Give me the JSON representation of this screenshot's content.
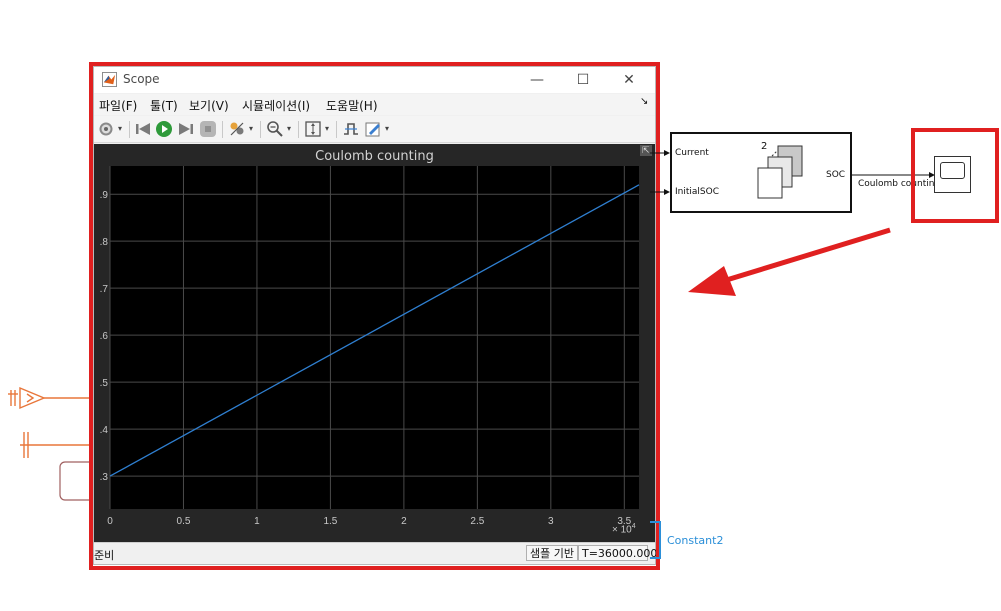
{
  "window": {
    "title": "Scope",
    "minimize": "—",
    "maximize": "☐",
    "close": "✕"
  },
  "menu": {
    "items": [
      "파일(F)",
      "툴(T)",
      "보기(V)",
      "시뮬레이션(I)",
      "도움말(H)"
    ],
    "overflow": "↘"
  },
  "toolbar": {
    "icons": [
      "settings-icon",
      "step-back-icon",
      "run-icon",
      "step-forward-icon",
      "stop-icon",
      "highlight-icon",
      "zoom-icon",
      "scale-axes-icon",
      "triggers-icon",
      "style-icon"
    ],
    "drop": "▾"
  },
  "plot": {
    "title": "Coulomb counting",
    "exponent_base": "× 10",
    "exponent_power": "4",
    "undock_label": "⇱"
  },
  "chart_data": {
    "type": "line",
    "title": "Coulomb counting",
    "xlabel": "",
    "ylabel": "",
    "x_multiplier": "×10^4",
    "xlim": [
      0,
      3.6
    ],
    "ylim": [
      0.23,
      0.96
    ],
    "xticks": [
      0,
      0.5,
      1,
      1.5,
      2,
      2.5,
      3,
      3.5
    ],
    "xtick_labels": [
      "0",
      "0.5",
      "1",
      "1.5",
      "2",
      "2.5",
      "3",
      "3.5"
    ],
    "yticks": [
      0.3,
      0.4,
      0.5,
      0.6,
      0.7,
      0.8,
      0.9
    ],
    "ytick_labels": [
      ".3",
      ".4",
      ".5",
      ".6",
      ".7",
      ".8",
      ".9"
    ],
    "grid": true,
    "line_color": "#2f7fd0",
    "series": [
      {
        "x": [
          0,
          3.6
        ],
        "y": [
          0.3,
          0.92
        ]
      }
    ]
  },
  "status": {
    "ready": "준비",
    "sample_based": "샘플 기반",
    "time": "T=36000.000"
  },
  "diagram": {
    "soc_block": {
      "ports_in": [
        "Current",
        "InitialSOC"
      ],
      "port_out": "SOC",
      "stack_count": "2"
    },
    "scope_block_label": "Coulomb counting",
    "constant_label": "Constant2"
  },
  "colors": {
    "highlight": "#e02020",
    "plot_bg": "#262626",
    "axes_bg": "#000000",
    "grid": "#4a4a4a",
    "signal_lines": "#e8763a"
  }
}
